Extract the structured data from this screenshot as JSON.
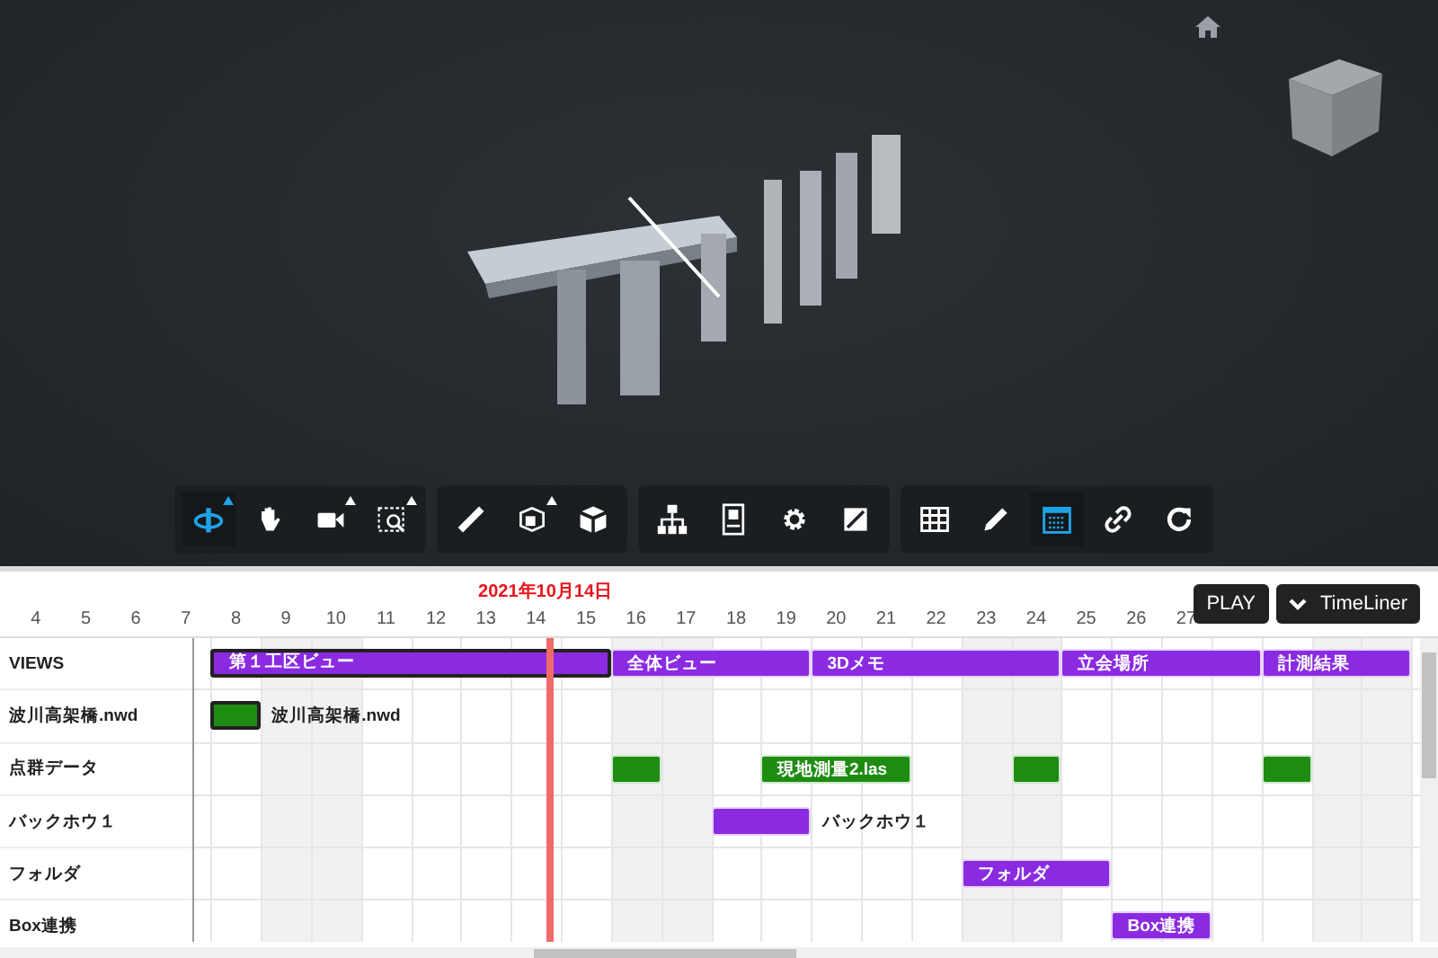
{
  "viewer": {
    "toolbar": {
      "groups": [
        {
          "tools": [
            {
              "kind": "orbit",
              "selected": true,
              "flyout": true
            },
            {
              "kind": "pan",
              "selected": false,
              "flyout": false
            },
            {
              "kind": "camera",
              "selected": false,
              "flyout": true
            },
            {
              "kind": "zoom-window",
              "selected": false,
              "flyout": true
            }
          ]
        },
        {
          "tools": [
            {
              "kind": "ruler",
              "selected": false,
              "flyout": false
            },
            {
              "kind": "section",
              "selected": false,
              "flyout": true
            },
            {
              "kind": "explode",
              "selected": false,
              "flyout": false
            }
          ]
        },
        {
          "tools": [
            {
              "kind": "tree",
              "selected": false,
              "flyout": false
            },
            {
              "kind": "properties",
              "selected": false,
              "flyout": false
            },
            {
              "kind": "gear",
              "selected": false,
              "flyout": false
            },
            {
              "kind": "fullscreen",
              "selected": false,
              "flyout": false
            }
          ]
        },
        {
          "tools": [
            {
              "kind": "table",
              "selected": false,
              "flyout": false
            },
            {
              "kind": "pencil",
              "selected": false,
              "flyout": false
            },
            {
              "kind": "calendar",
              "selected": true,
              "flyout": false
            },
            {
              "kind": "link",
              "selected": false,
              "flyout": false
            },
            {
              "kind": "refresh",
              "selected": false,
              "flyout": false
            }
          ]
        }
      ]
    }
  },
  "timeliner": {
    "current_date": "2021年10月14日",
    "buttons": [
      {
        "kind": "play",
        "label": "PLAY"
      },
      {
        "kind": "collapse",
        "label": "TimeLiner"
      }
    ],
    "days": [
      {
        "label": "4",
        "today": false
      },
      {
        "label": "5",
        "today": false
      },
      {
        "label": "6",
        "today": false
      },
      {
        "label": "7",
        "weekend": false,
        "today": false
      },
      {
        "label": "8",
        "weekend": false,
        "today": false
      },
      {
        "label": "9",
        "weekend": true,
        "today": false
      },
      {
        "label": "10",
        "weekend": true,
        "today": false
      },
      {
        "label": "11",
        "weekend": false,
        "today": false
      },
      {
        "label": "12",
        "weekend": false,
        "today": false
      },
      {
        "label": "13",
        "weekend": false,
        "today": false
      },
      {
        "label": "14",
        "weekend": false,
        "today": true
      },
      {
        "label": "15",
        "weekend": false,
        "today": false
      },
      {
        "label": "16",
        "weekend": true,
        "today": false
      },
      {
        "label": "17",
        "weekend": true,
        "today": false
      },
      {
        "label": "18",
        "weekend": false,
        "today": false
      },
      {
        "label": "19",
        "weekend": false,
        "today": false
      },
      {
        "label": "20",
        "weekend": false,
        "today": false
      },
      {
        "label": "21",
        "weekend": false,
        "today": false
      },
      {
        "label": "22",
        "weekend": false,
        "today": false
      },
      {
        "label": "23",
        "weekend": true,
        "today": false
      },
      {
        "label": "24",
        "weekend": true,
        "today": false
      },
      {
        "label": "25",
        "weekend": false,
        "today": false
      },
      {
        "label": "26",
        "weekend": false,
        "today": false
      },
      {
        "label": "27",
        "weekend": false,
        "today": false
      }
    ],
    "rows": [
      {
        "label": "VIEWS",
        "cells": [
          {
            "kind": "bar",
            "label": "第１工区ビュー",
            "label_outside": false,
            "color": "#8a2be2",
            "selected": true
          },
          {
            "kind": "more"
          },
          {
            "kind": "more"
          },
          {
            "kind": "more"
          },
          {
            "kind": "more"
          },
          {
            "kind": "more"
          },
          {
            "kind": "more"
          },
          {
            "kind": "more"
          },
          {
            "kind": "bar",
            "label": "全体ビュー",
            "label_outside": false,
            "color": "#8a2be2",
            "selected": false
          },
          {
            "kind": "more"
          },
          {
            "kind": "more"
          },
          {
            "kind": "more"
          },
          {
            "kind": "bar",
            "label": "3Dメモ",
            "label_outside": false,
            "color": "#8a2be2",
            "selected": false
          },
          {
            "kind": "more"
          },
          {
            "kind": "more"
          },
          {
            "kind": "more"
          },
          {
            "kind": "more"
          },
          {
            "kind": "bar",
            "label": "立会場所",
            "label_outside": false,
            "color": "#8a2be2",
            "selected": false
          },
          {
            "kind": "more"
          },
          {
            "kind": "more"
          },
          {
            "kind": "more"
          },
          {
            "kind": "bar",
            "label": "計測結果",
            "label_outside": false,
            "color": "#8a2be2",
            "selected": false
          },
          {
            "kind": "more"
          },
          {
            "kind": "more"
          }
        ]
      },
      {
        "label": "波川高架橋.nwd",
        "cells": [
          {
            "kind": "bar",
            "label": "波川高架橋.nwd",
            "label_outside": true,
            "color": "#1e8c12",
            "selected": true
          }
        ]
      },
      {
        "label": "点群データ",
        "cells": [
          {
            "kind": "empty"
          },
          {
            "kind": "empty"
          },
          {
            "kind": "empty"
          },
          {
            "kind": "empty"
          },
          {
            "kind": "empty"
          },
          {
            "kind": "empty"
          },
          {
            "kind": "empty"
          },
          {
            "kind": "empty"
          },
          {
            "kind": "bar",
            "color": "#1e8c12",
            "selected": false
          },
          {
            "kind": "empty"
          },
          {
            "kind": "empty"
          },
          {
            "kind": "bar",
            "label": "現地測量2.las",
            "label_outside": false,
            "color": "#1e8c12",
            "selected": false
          },
          {
            "kind": "more"
          },
          {
            "kind": "more"
          },
          {
            "kind": "empty"
          },
          {
            "kind": "empty"
          },
          {
            "kind": "bar",
            "color": "#1e8c12",
            "selected": false
          },
          {
            "kind": "empty"
          },
          {
            "kind": "empty"
          },
          {
            "kind": "empty"
          },
          {
            "kind": "empty"
          },
          {
            "kind": "bar",
            "color": "#1e8c12",
            "selected": false
          }
        ]
      },
      {
        "label": "バックホウ１",
        "cells": [
          {
            "kind": "empty"
          },
          {
            "kind": "empty"
          },
          {
            "kind": "empty"
          },
          {
            "kind": "empty"
          },
          {
            "kind": "empty"
          },
          {
            "kind": "empty"
          },
          {
            "kind": "empty"
          },
          {
            "kind": "empty"
          },
          {
            "kind": "empty"
          },
          {
            "kind": "empty"
          },
          {
            "kind": "bar",
            "label": "バックホウ１",
            "label_outside": true,
            "color": "#8a2be2",
            "selected": false
          },
          {
            "kind": "more"
          }
        ]
      },
      {
        "label": "フォルダ",
        "cells": [
          {
            "kind": "empty"
          },
          {
            "kind": "empty"
          },
          {
            "kind": "empty"
          },
          {
            "kind": "empty"
          },
          {
            "kind": "empty"
          },
          {
            "kind": "empty"
          },
          {
            "kind": "empty"
          },
          {
            "kind": "empty"
          },
          {
            "kind": "empty"
          },
          {
            "kind": "empty"
          },
          {
            "kind": "empty"
          },
          {
            "kind": "empty"
          },
          {
            "kind": "empty"
          },
          {
            "kind": "empty"
          },
          {
            "kind": "empty"
          },
          {
            "kind": "bar",
            "label": "フォルダ",
            "label_outside": false,
            "color": "#8a2be2",
            "selected": false
          },
          {
            "kind": "more"
          },
          {
            "kind": "more"
          }
        ]
      },
      {
        "label": "Box連携",
        "cells": [
          {
            "kind": "empty"
          },
          {
            "kind": "empty"
          },
          {
            "kind": "empty"
          },
          {
            "kind": "empty"
          },
          {
            "kind": "empty"
          },
          {
            "kind": "empty"
          },
          {
            "kind": "empty"
          },
          {
            "kind": "empty"
          },
          {
            "kind": "empty"
          },
          {
            "kind": "empty"
          },
          {
            "kind": "empty"
          },
          {
            "kind": "empty"
          },
          {
            "kind": "empty"
          },
          {
            "kind": "empty"
          },
          {
            "kind": "empty"
          },
          {
            "kind": "empty"
          },
          {
            "kind": "empty"
          },
          {
            "kind": "empty"
          },
          {
            "kind": "bar",
            "label": "Box連携",
            "label_outside": false,
            "color": "#8a2be2",
            "selected": false
          },
          {
            "kind": "more"
          }
        ]
      }
    ]
  }
}
